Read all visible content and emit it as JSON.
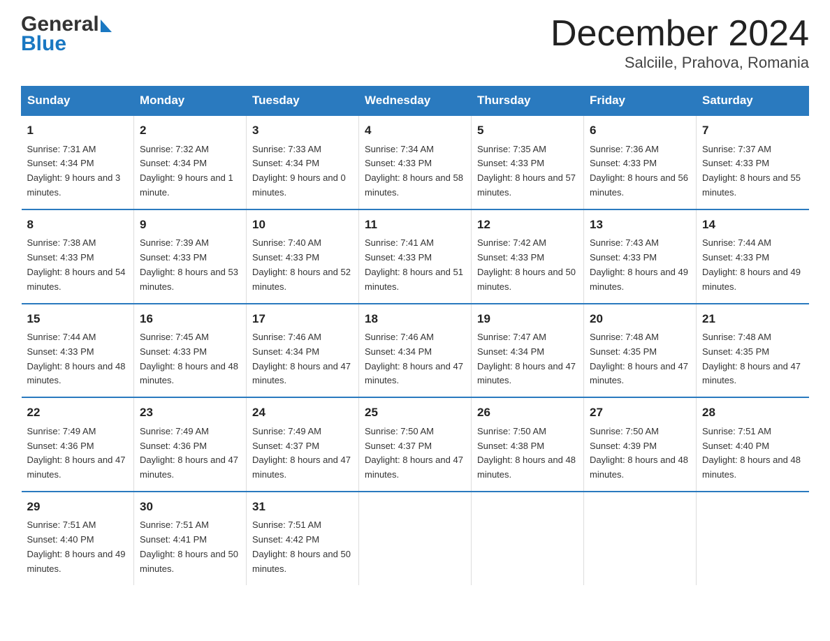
{
  "header": {
    "title": "December 2024",
    "subtitle": "Salciile, Prahova, Romania",
    "logo_general": "General",
    "logo_blue": "Blue"
  },
  "weekdays": [
    "Sunday",
    "Monday",
    "Tuesday",
    "Wednesday",
    "Thursday",
    "Friday",
    "Saturday"
  ],
  "weeks": [
    [
      {
        "day": "1",
        "sunrise": "7:31 AM",
        "sunset": "4:34 PM",
        "daylight": "9 hours and 3 minutes."
      },
      {
        "day": "2",
        "sunrise": "7:32 AM",
        "sunset": "4:34 PM",
        "daylight": "9 hours and 1 minute."
      },
      {
        "day": "3",
        "sunrise": "7:33 AM",
        "sunset": "4:34 PM",
        "daylight": "9 hours and 0 minutes."
      },
      {
        "day": "4",
        "sunrise": "7:34 AM",
        "sunset": "4:33 PM",
        "daylight": "8 hours and 58 minutes."
      },
      {
        "day": "5",
        "sunrise": "7:35 AM",
        "sunset": "4:33 PM",
        "daylight": "8 hours and 57 minutes."
      },
      {
        "day": "6",
        "sunrise": "7:36 AM",
        "sunset": "4:33 PM",
        "daylight": "8 hours and 56 minutes."
      },
      {
        "day": "7",
        "sunrise": "7:37 AM",
        "sunset": "4:33 PM",
        "daylight": "8 hours and 55 minutes."
      }
    ],
    [
      {
        "day": "8",
        "sunrise": "7:38 AM",
        "sunset": "4:33 PM",
        "daylight": "8 hours and 54 minutes."
      },
      {
        "day": "9",
        "sunrise": "7:39 AM",
        "sunset": "4:33 PM",
        "daylight": "8 hours and 53 minutes."
      },
      {
        "day": "10",
        "sunrise": "7:40 AM",
        "sunset": "4:33 PM",
        "daylight": "8 hours and 52 minutes."
      },
      {
        "day": "11",
        "sunrise": "7:41 AM",
        "sunset": "4:33 PM",
        "daylight": "8 hours and 51 minutes."
      },
      {
        "day": "12",
        "sunrise": "7:42 AM",
        "sunset": "4:33 PM",
        "daylight": "8 hours and 50 minutes."
      },
      {
        "day": "13",
        "sunrise": "7:43 AM",
        "sunset": "4:33 PM",
        "daylight": "8 hours and 49 minutes."
      },
      {
        "day": "14",
        "sunrise": "7:44 AM",
        "sunset": "4:33 PM",
        "daylight": "8 hours and 49 minutes."
      }
    ],
    [
      {
        "day": "15",
        "sunrise": "7:44 AM",
        "sunset": "4:33 PM",
        "daylight": "8 hours and 48 minutes."
      },
      {
        "day": "16",
        "sunrise": "7:45 AM",
        "sunset": "4:33 PM",
        "daylight": "8 hours and 48 minutes."
      },
      {
        "day": "17",
        "sunrise": "7:46 AM",
        "sunset": "4:34 PM",
        "daylight": "8 hours and 47 minutes."
      },
      {
        "day": "18",
        "sunrise": "7:46 AM",
        "sunset": "4:34 PM",
        "daylight": "8 hours and 47 minutes."
      },
      {
        "day": "19",
        "sunrise": "7:47 AM",
        "sunset": "4:34 PM",
        "daylight": "8 hours and 47 minutes."
      },
      {
        "day": "20",
        "sunrise": "7:48 AM",
        "sunset": "4:35 PM",
        "daylight": "8 hours and 47 minutes."
      },
      {
        "day": "21",
        "sunrise": "7:48 AM",
        "sunset": "4:35 PM",
        "daylight": "8 hours and 47 minutes."
      }
    ],
    [
      {
        "day": "22",
        "sunrise": "7:49 AM",
        "sunset": "4:36 PM",
        "daylight": "8 hours and 47 minutes."
      },
      {
        "day": "23",
        "sunrise": "7:49 AM",
        "sunset": "4:36 PM",
        "daylight": "8 hours and 47 minutes."
      },
      {
        "day": "24",
        "sunrise": "7:49 AM",
        "sunset": "4:37 PM",
        "daylight": "8 hours and 47 minutes."
      },
      {
        "day": "25",
        "sunrise": "7:50 AM",
        "sunset": "4:37 PM",
        "daylight": "8 hours and 47 minutes."
      },
      {
        "day": "26",
        "sunrise": "7:50 AM",
        "sunset": "4:38 PM",
        "daylight": "8 hours and 48 minutes."
      },
      {
        "day": "27",
        "sunrise": "7:50 AM",
        "sunset": "4:39 PM",
        "daylight": "8 hours and 48 minutes."
      },
      {
        "day": "28",
        "sunrise": "7:51 AM",
        "sunset": "4:40 PM",
        "daylight": "8 hours and 48 minutes."
      }
    ],
    [
      {
        "day": "29",
        "sunrise": "7:51 AM",
        "sunset": "4:40 PM",
        "daylight": "8 hours and 49 minutes."
      },
      {
        "day": "30",
        "sunrise": "7:51 AM",
        "sunset": "4:41 PM",
        "daylight": "8 hours and 50 minutes."
      },
      {
        "day": "31",
        "sunrise": "7:51 AM",
        "sunset": "4:42 PM",
        "daylight": "8 hours and 50 minutes."
      },
      null,
      null,
      null,
      null
    ]
  ],
  "labels": {
    "sunrise": "Sunrise:",
    "sunset": "Sunset:",
    "daylight": "Daylight:"
  },
  "colors": {
    "header_bg": "#2a7abf",
    "header_text": "#ffffff",
    "border": "#2a7abf",
    "logo_blue": "#1a78c2",
    "logo_dark": "#333333"
  }
}
